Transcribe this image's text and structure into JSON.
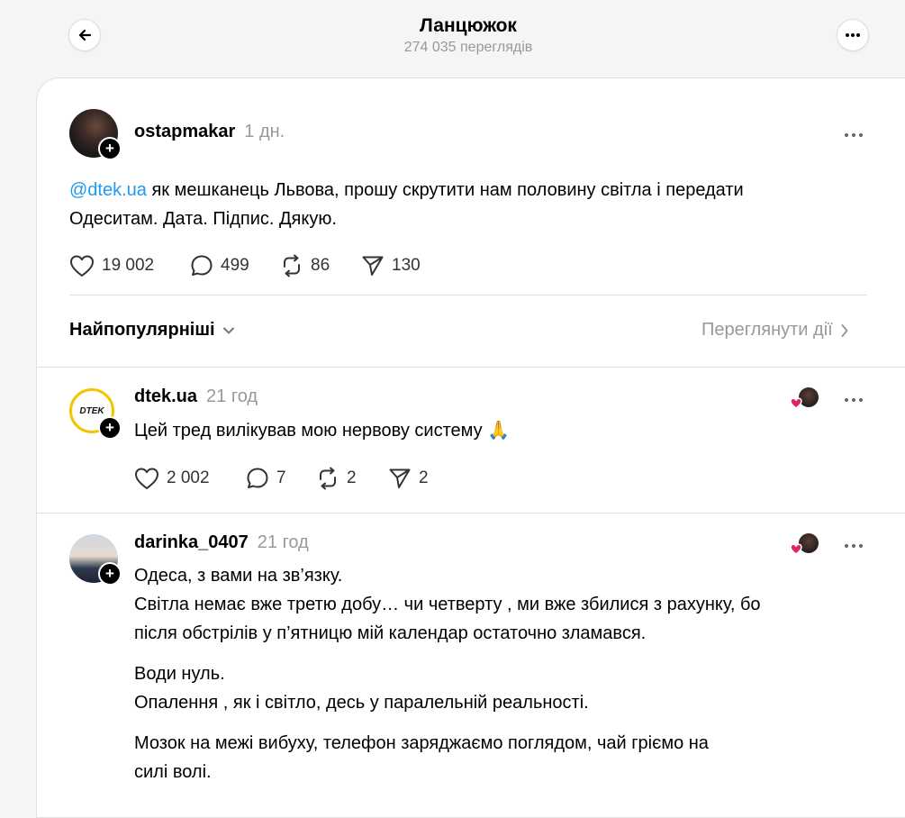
{
  "header": {
    "title": "Ланцюжок",
    "views": "274 035 переглядів"
  },
  "post": {
    "username": "ostapmakar",
    "time": "1 дн.",
    "mention": "@dtek.ua",
    "text_line1": " як мешканець Львова, прошу скрутити нам половину світла і передати",
    "text_line2": "Одеситам. Дата. Підпис. Дякую.",
    "likes": "19 002",
    "comments": "499",
    "reposts": "86",
    "shares": "130"
  },
  "sort": {
    "label": "Найпопулярніші",
    "view_activity": "Переглянути дії"
  },
  "replies": [
    {
      "username": "dtek.ua",
      "time": "21 год",
      "avatar_text": "DTEK",
      "text": "Цей тред вилікував мою нервову систему 🙏",
      "likes": "2 002",
      "comments": "7",
      "reposts": "2",
      "shares": "2"
    },
    {
      "username": "darinka_0407",
      "time": "21 год",
      "p1_line1": "Одеса, з вами на зв’язку.",
      "p1_line2": "Світла немає вже третю добу… чи четверту , ми вже збилися з рахунку, бо",
      "p1_line3": "після обстрілів у п’ятницю мій календар остаточно зламався.",
      "p2_line1": "Води нуль.",
      "p2_line2": "Опалення , як і світло, десь у паралельній реальності.",
      "p3_line1": "Мозок на межі вибуху, телефон заряджаємо поглядом, чай гріємо на",
      "p3_line2": "силі волі."
    }
  ],
  "colors": {
    "accent_link": "#1d9bf0",
    "heart_red": "#e0245e",
    "dtek_yellow": "#f5c400"
  },
  "icons": [
    "back-arrow-icon",
    "more-icon",
    "heart-icon",
    "comment-icon",
    "repost-icon",
    "share-icon",
    "chevron-down-icon",
    "chevron-right-icon",
    "plus-icon"
  ]
}
